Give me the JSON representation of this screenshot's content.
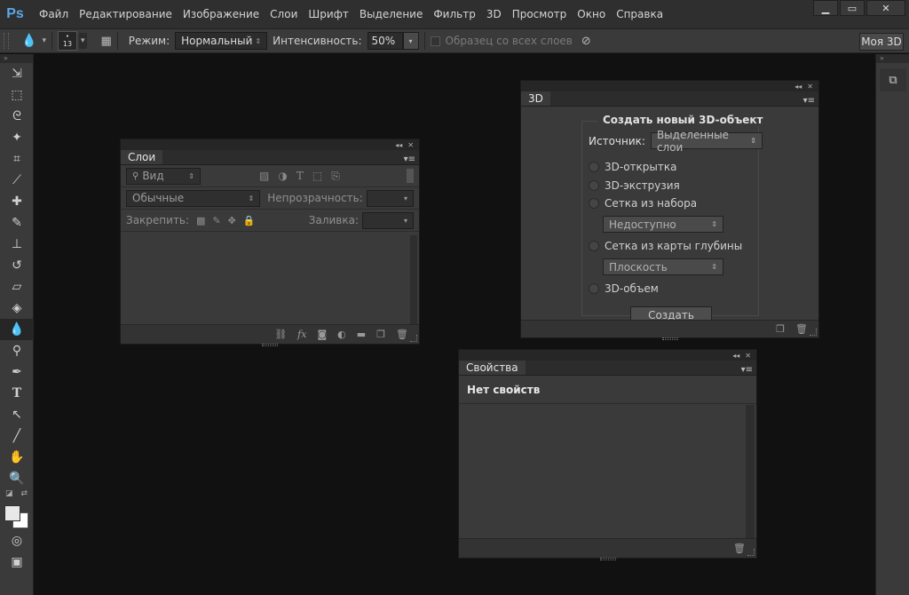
{
  "app": {
    "logo": "Ps"
  },
  "menu": [
    "Файл",
    "Редактирование",
    "Изображение",
    "Слои",
    "Шрифт",
    "Выделение",
    "Фильтр",
    "3D",
    "Просмотр",
    "Окно",
    "Справка"
  ],
  "options": {
    "brush_size": "13",
    "mode_label": "Режим:",
    "mode_value": "Нормальный",
    "intensity_label": "Интенсивность:",
    "intensity_value": "50%",
    "sample_all_label": "Образец со всех слоев",
    "workspace_button": "Моя 3D"
  },
  "layers_panel": {
    "tab": "Слои",
    "filter_value": "Вид",
    "blend_mode": "Обычные",
    "opacity_label": "Непрозрачность:",
    "lock_label": "Закрепить:",
    "fill_label": "Заливка:"
  },
  "panel_3d": {
    "tab": "3D",
    "group_title": "Создать новый 3D-объект",
    "source_label": "Источник:",
    "source_value": "Выделенные слои",
    "options": {
      "postcard": "3D-открытка",
      "extrusion": "3D-экструзия",
      "preset_mesh": "Сетка из набора",
      "preset_mesh_value": "Недоступно",
      "depth_mesh": "Сетка из карты глубины",
      "depth_mesh_value": "Плоскость",
      "volume": "3D-объем"
    },
    "create_button": "Создать"
  },
  "properties_panel": {
    "tab": "Свойства",
    "message": "Нет свойств"
  },
  "colors": {
    "background": "#111111",
    "panel": "#3a3a3a",
    "bar": "#2f2f2f",
    "logo": "#5aa7e8"
  }
}
